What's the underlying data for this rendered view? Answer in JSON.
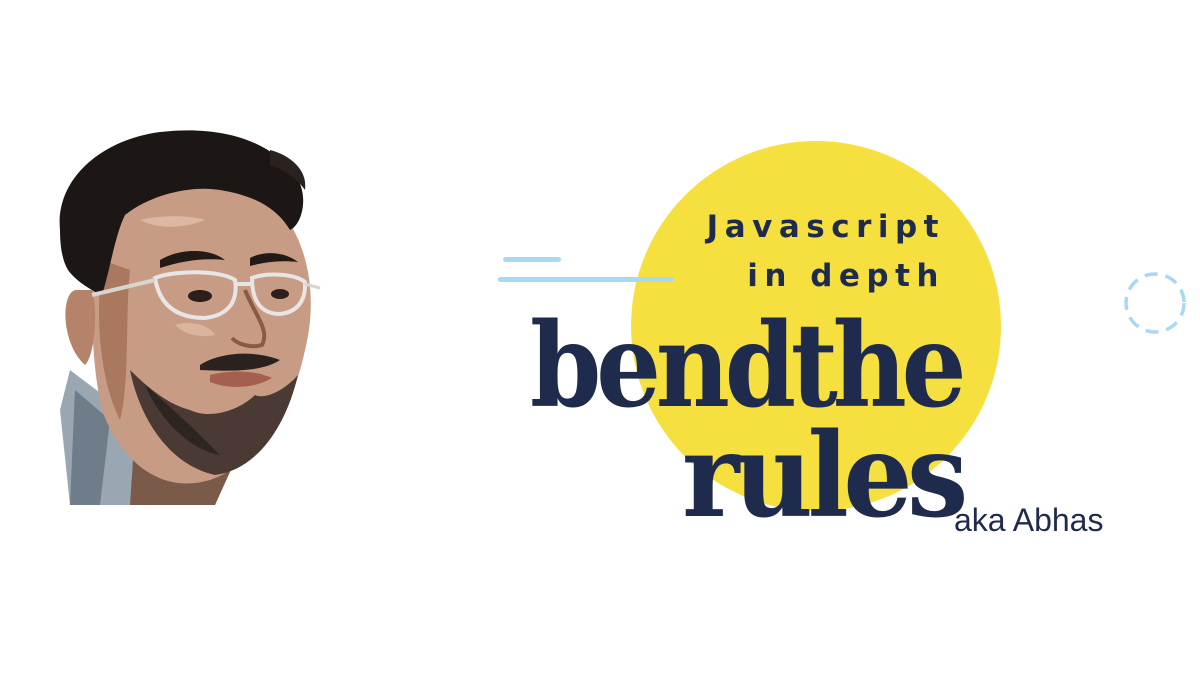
{
  "colors": {
    "navy": "#1f2b4c",
    "yellow": "#f6e03f",
    "light_blue": "#a9d8f2"
  },
  "portrait": {
    "icon": "illustrated-portrait"
  },
  "headline": {
    "subtitle_line1": "Javascript",
    "subtitle_line2": "in depth",
    "title_line1": "bendthe",
    "title_line2": "rules",
    "aka": "aka Abhas"
  }
}
